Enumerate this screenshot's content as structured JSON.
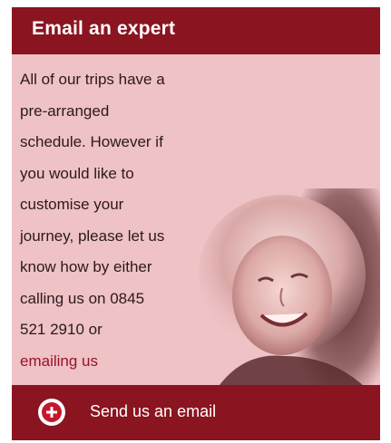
{
  "widget": {
    "title": "Email an expert",
    "body_lines": [
      "All of our trips have a",
      "pre-arranged",
      "schedule. However if",
      "you would like to",
      "customise your",
      "journey, please let us",
      "know how by either",
      "calling us on 0845",
      "521 2910 or"
    ],
    "link_text": "emailing us",
    "footer": {
      "icon": "plus-circle-icon",
      "label": "Send us an email"
    },
    "colors": {
      "header_bg": "#8a1420",
      "panel_bg": "#efc2c6",
      "link": "#9a1226",
      "text": "#2a1a1a"
    }
  }
}
